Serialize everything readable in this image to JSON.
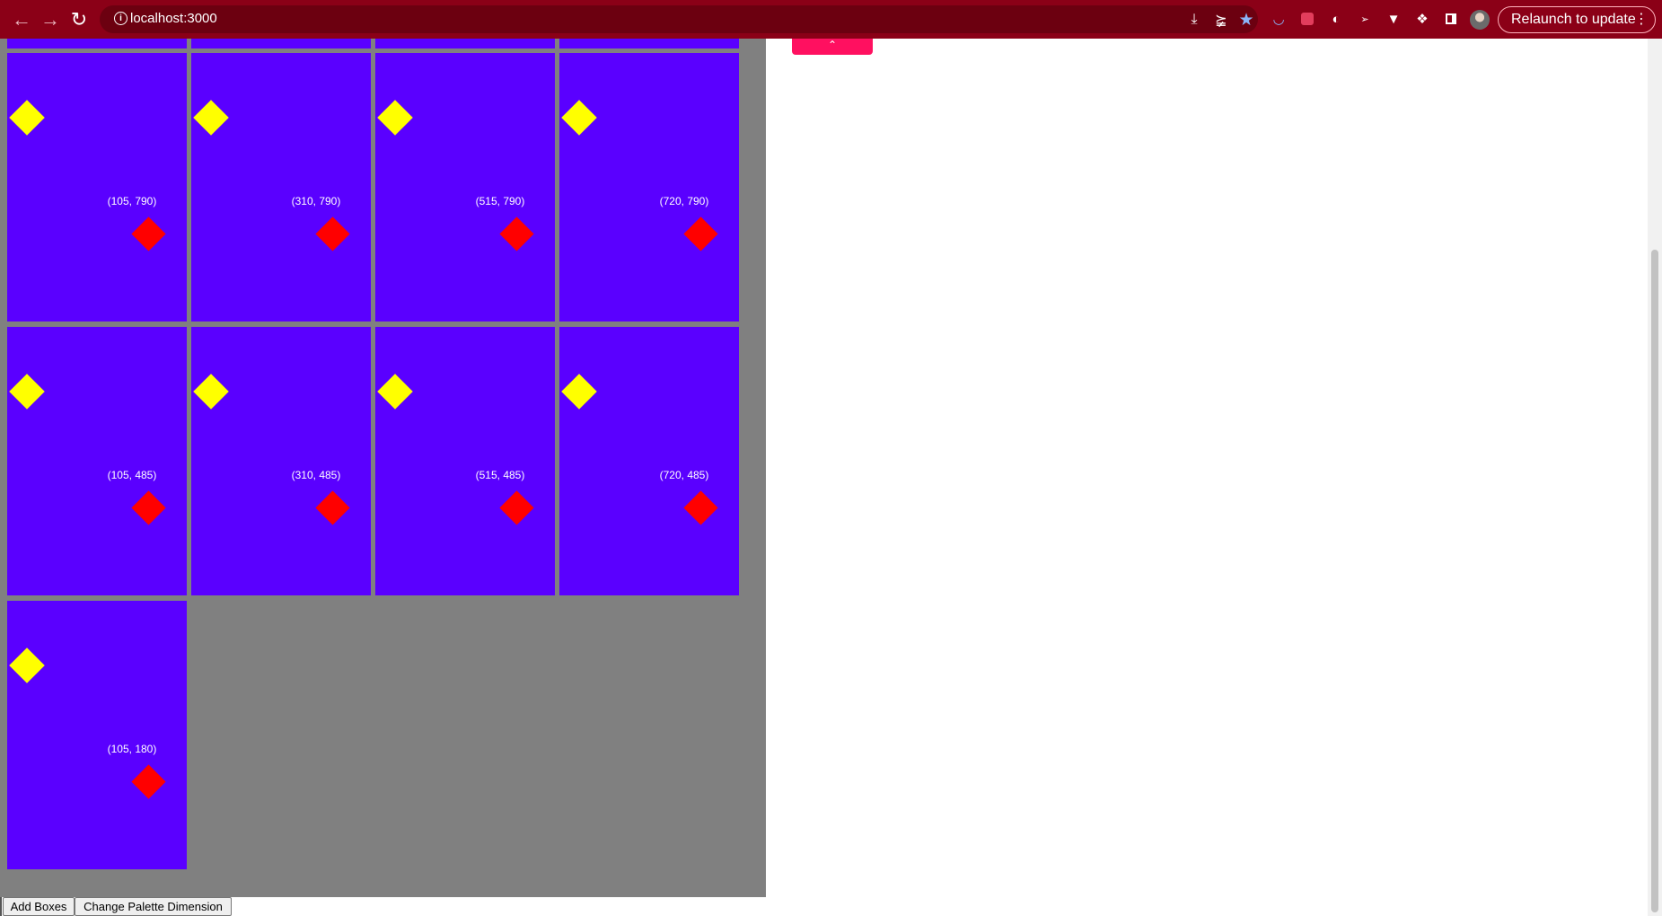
{
  "browser": {
    "url": "localhost:3000",
    "relaunch_label": "Relaunch to update",
    "icons": [
      "back-icon",
      "forward-icon",
      "reload-icon",
      "info-icon",
      "install-icon",
      "share-icon",
      "star-icon",
      "extension-icons",
      "puzzle-icon",
      "side-panel-icon",
      "avatar"
    ]
  },
  "palette": {
    "background": "#808080",
    "box_color": "#5a00ff",
    "marker_colors": {
      "top_left": "#ffff00",
      "bottom_right": "#ff0000"
    },
    "rows": [
      {
        "boxes": [
          {
            "label": "(105, 790)"
          },
          {
            "label": "(310, 790)"
          },
          {
            "label": "(515, 790)"
          },
          {
            "label": "(720, 790)"
          }
        ]
      },
      {
        "boxes": [
          {
            "label": "(105, 485)"
          },
          {
            "label": "(310, 485)"
          },
          {
            "label": "(515, 485)"
          },
          {
            "label": "(720, 485)"
          }
        ]
      },
      {
        "boxes": [
          {
            "label": "(105, 180)"
          }
        ]
      }
    ]
  },
  "controls": {
    "add_boxes_label": "Add Boxes",
    "change_dimension_label": "Change Palette Dimension"
  },
  "accent_tab_color": "#ff1060"
}
